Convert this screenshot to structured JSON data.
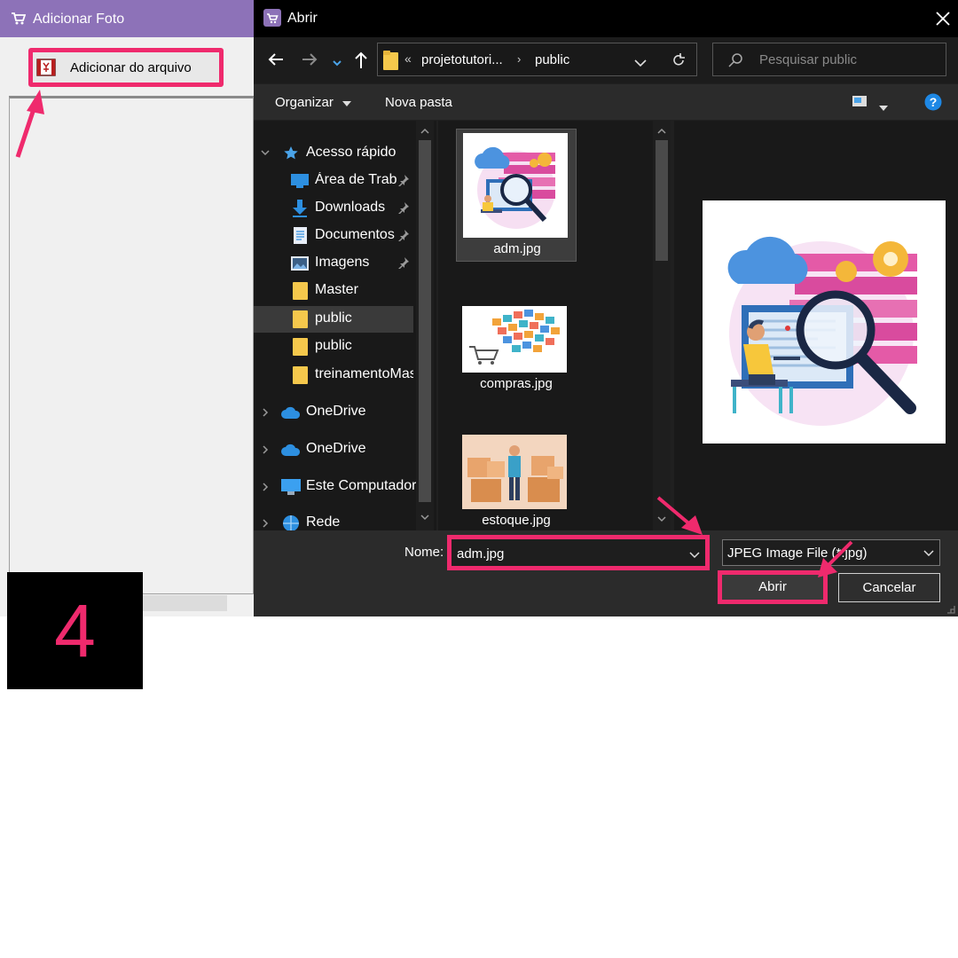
{
  "background_window": {
    "title": "Adicionar Foto",
    "add_button_label": "Adicionar do arquivo"
  },
  "step_number": "4",
  "dialog": {
    "title": "Abrir",
    "breadcrumb_overflow": "«",
    "breadcrumb": [
      "projetotutori...",
      "public"
    ],
    "search_placeholder": "Pesquisar public",
    "toolbar": {
      "organize": "Organizar",
      "new_folder": "Nova pasta"
    },
    "nav_items": [
      {
        "label": "Acesso rápido",
        "icon": "star-icon"
      },
      {
        "label": "Área de Trabalho",
        "icon": "desktop-icon",
        "pinned": true
      },
      {
        "label": "Downloads",
        "icon": "download-icon",
        "pinned": true
      },
      {
        "label": "Documentos",
        "icon": "document-icon",
        "pinned": true
      },
      {
        "label": "Imagens",
        "icon": "image-icon",
        "pinned": true
      },
      {
        "label": "Master",
        "icon": "folder-icon"
      },
      {
        "label": "public",
        "icon": "folder-icon",
        "selected": true
      },
      {
        "label": "public",
        "icon": "folder-icon"
      },
      {
        "label": "treinamentoMaster",
        "icon": "folder-icon"
      },
      {
        "label": "OneDrive",
        "icon": "cloud-icon"
      },
      {
        "label": "OneDrive",
        "icon": "cloud-icon"
      },
      {
        "label": "Este Computador",
        "icon": "computer-icon"
      },
      {
        "label": "Rede",
        "icon": "network-icon"
      }
    ],
    "files": [
      {
        "name": "adm.jpg",
        "selected": true
      },
      {
        "name": "compras.jpg"
      },
      {
        "name": "estoque.jpg"
      }
    ],
    "filename_label": "Nome:",
    "filename_value": "adm.jpg",
    "filetype_value": "JPEG Image File (*.jpg)",
    "open_button": "Abrir",
    "cancel_button": "Cancelar"
  },
  "colors": {
    "highlight": "#ef2a6d",
    "dialog_bg": "#202020",
    "titlebar_bg": "#8d72b8",
    "help": "#1e88e5"
  }
}
